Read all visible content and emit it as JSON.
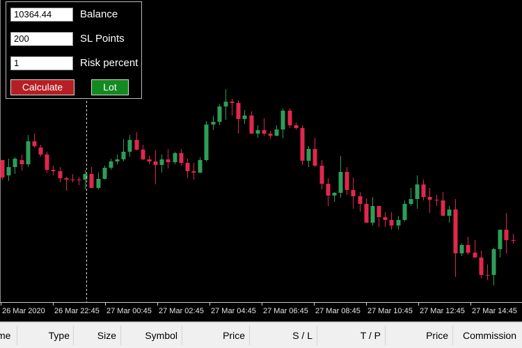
{
  "panel": {
    "balance": {
      "value": "10364.44",
      "label": "Balance"
    },
    "sl_points": {
      "value": "200",
      "label": "SL Points"
    },
    "risk_percent": {
      "value": "1",
      "label": "Risk percent"
    },
    "calculate_label": "Calculate",
    "lot_label": "Lot"
  },
  "colors": {
    "bull": "#2e9d57",
    "bear": "#e0274c",
    "grid": "#d0d0d0",
    "background": "#000000"
  },
  "time_axis": {
    "labels": [
      "26 Mar 2020",
      "26 Mar 22:45",
      "27 Mar 00:45",
      "27 Mar 02:45",
      "27 Mar 04:45",
      "27 Mar 06:45",
      "27 Mar 08:45",
      "27 Mar 10:45",
      "27 Mar 12:45",
      "27 Mar 14:45"
    ]
  },
  "table": {
    "columns": [
      "me",
      "Type",
      "Size",
      "Symbol",
      "Price",
      "S / L",
      "T / P",
      "Price",
      "Commission"
    ]
  },
  "chart_data": {
    "type": "candlestick",
    "x_labels": [
      "26 Mar 2020",
      "26 Mar 22:45",
      "27 Mar 00:45",
      "27 Mar 02:45",
      "27 Mar 04:45",
      "27 Mar 06:45",
      "27 Mar 08:45",
      "27 Mar 10:45",
      "27 Mar 12:45",
      "27 Mar 14:45"
    ],
    "candles": [
      [
        230,
        232,
        258,
        255
      ],
      [
        252,
        228,
        260,
        240
      ],
      [
        240,
        226,
        250,
        228
      ],
      [
        230,
        222,
        245,
        236
      ],
      [
        236,
        194,
        240,
        203
      ],
      [
        203,
        192,
        212,
        210
      ],
      [
        212,
        208,
        225,
        222
      ],
      [
        222,
        218,
        248,
        244
      ],
      [
        244,
        238,
        252,
        246
      ],
      [
        246,
        240,
        262,
        256
      ],
      [
        256,
        254,
        274,
        258
      ],
      [
        258,
        250,
        262,
        258
      ],
      [
        258,
        254,
        266,
        258
      ],
      [
        258,
        244,
        272,
        250
      ],
      [
        250,
        240,
        262,
        270
      ],
      [
        270,
        248,
        272,
        257
      ],
      [
        257,
        238,
        258,
        241
      ],
      [
        241,
        228,
        244,
        232
      ],
      [
        232,
        222,
        236,
        229
      ],
      [
        229,
        200,
        232,
        218
      ],
      [
        218,
        194,
        225,
        201
      ],
      [
        201,
        190,
        216,
        215
      ],
      [
        215,
        208,
        230,
        229
      ],
      [
        229,
        224,
        236,
        232
      ],
      [
        232,
        216,
        265,
        237
      ],
      [
        237,
        222,
        248,
        229
      ],
      [
        229,
        214,
        242,
        233
      ],
      [
        233,
        218,
        236,
        220
      ],
      [
        220,
        214,
        238,
        234
      ],
      [
        234,
        228,
        256,
        246
      ],
      [
        246,
        234,
        258,
        248
      ],
      [
        248,
        226,
        249,
        230
      ],
      [
        230,
        174,
        232,
        179
      ],
      [
        179,
        166,
        187,
        175
      ],
      [
        175,
        150,
        180,
        153
      ],
      [
        153,
        128,
        172,
        146
      ],
      [
        146,
        142,
        166,
        148
      ],
      [
        148,
        144,
        192,
        171
      ],
      [
        171,
        158,
        178,
        166
      ],
      [
        166,
        160,
        190,
        192
      ],
      [
        192,
        180,
        198,
        187
      ],
      [
        187,
        170,
        195,
        192
      ],
      [
        192,
        188,
        200,
        195
      ],
      [
        195,
        180,
        196,
        186
      ],
      [
        186,
        156,
        198,
        159
      ],
      [
        159,
        156,
        184,
        180
      ],
      [
        180,
        176,
        186,
        184
      ],
      [
        184,
        180,
        237,
        231
      ],
      [
        231,
        210,
        240,
        214
      ],
      [
        214,
        198,
        240,
        238
      ],
      [
        238,
        230,
        272,
        264
      ],
      [
        264,
        256,
        296,
        281
      ],
      [
        281,
        276,
        290,
        277
      ],
      [
        277,
        224,
        284,
        247
      ],
      [
        247,
        240,
        280,
        273
      ],
      [
        273,
        255,
        300,
        282
      ],
      [
        282,
        276,
        304,
        293
      ],
      [
        293,
        285,
        320,
        320
      ],
      [
        320,
        283,
        324,
        296
      ],
      [
        296,
        300,
        326,
        312
      ],
      [
        312,
        305,
        326,
        316
      ],
      [
        316,
        305,
        330,
        324
      ],
      [
        324,
        310,
        330,
        316
      ],
      [
        316,
        288,
        318,
        293
      ],
      [
        293,
        270,
        296,
        286
      ],
      [
        286,
        252,
        300,
        265
      ],
      [
        265,
        258,
        288,
        283
      ],
      [
        283,
        270,
        306,
        287
      ],
      [
        287,
        280,
        296,
        288
      ],
      [
        288,
        276,
        310,
        310
      ],
      [
        310,
        296,
        320,
        301
      ],
      [
        301,
        286,
        398,
        364
      ],
      [
        364,
        350,
        368,
        352
      ],
      [
        352,
        340,
        366,
        363
      ],
      [
        363,
        345,
        370,
        370
      ],
      [
        370,
        360,
        400,
        395
      ],
      [
        395,
        380,
        402,
        395
      ],
      [
        395,
        356,
        410,
        358
      ],
      [
        358,
        330,
        370,
        330
      ],
      [
        330,
        306,
        364,
        345
      ],
      [
        345,
        336,
        350,
        346
      ]
    ],
    "cursor_x_label": "26 Mar 22:45"
  }
}
